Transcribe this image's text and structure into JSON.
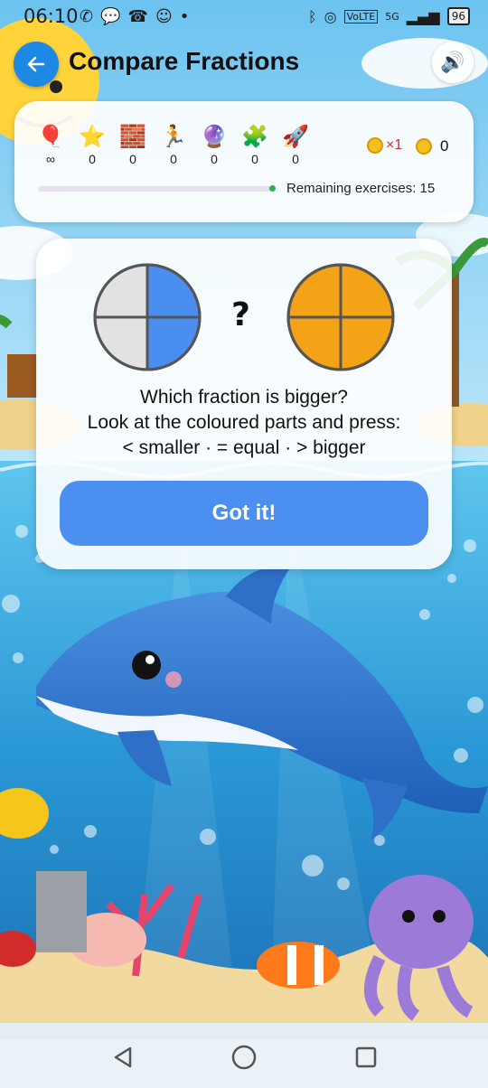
{
  "status_bar": {
    "time": "06:10",
    "left_icons": [
      "whatsapp-icon",
      "chat-icon",
      "missed-call-icon",
      "face-icon",
      "dot-icon"
    ],
    "network_labels": [
      "VoLTE",
      "5G"
    ],
    "battery": "96"
  },
  "header": {
    "title": "Compare Fractions",
    "back_icon": "arrow-left-icon",
    "sound_icon": "speaker-icon"
  },
  "stats": {
    "items": [
      {
        "icon": "balloon-icon",
        "glyph": "🎈",
        "value": "∞"
      },
      {
        "icon": "star-icon",
        "glyph": "⭐",
        "value": "0"
      },
      {
        "icon": "brick-icon",
        "glyph": "🧱",
        "value": "0"
      },
      {
        "icon": "runner-icon",
        "glyph": "🏃",
        "value": "0"
      },
      {
        "icon": "crystal-ball-icon",
        "glyph": "🔮",
        "value": "0"
      },
      {
        "icon": "puzzle-icon",
        "glyph": "🧩",
        "value": "0"
      },
      {
        "icon": "rocket-icon",
        "glyph": "🚀",
        "value": "0"
      }
    ],
    "coin_multiplier": "×1",
    "coins": "0",
    "remaining_text": "Remaining exercises: 15",
    "colors": {
      "progress_dot": "#2bb24c",
      "track": "#e8dff0"
    }
  },
  "question": {
    "left_fraction": {
      "parts": 4,
      "filled": 2,
      "fill_color": "#4a8ef0",
      "empty_color": "#e2e2e2"
    },
    "right_fraction": {
      "parts": 4,
      "filled": 4,
      "fill_color": "#f5a316",
      "empty_color": "#e2e2e2"
    },
    "compare_symbol": "?",
    "line1": "Which fraction is bigger?",
    "line2": "Look at the coloured parts and press:",
    "line3": "< smaller · = equal · > bigger",
    "button_label": "Got it!",
    "colors": {
      "button": "#4b8ff0"
    }
  },
  "navbar": {
    "icons": [
      "back-triangle-icon",
      "home-circle-icon",
      "recents-square-icon"
    ]
  }
}
